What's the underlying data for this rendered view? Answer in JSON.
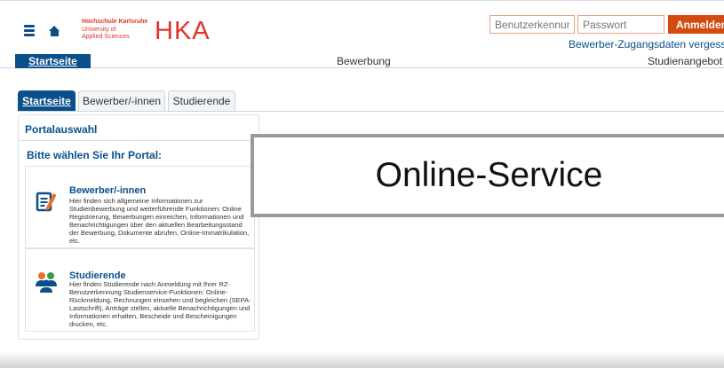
{
  "header": {
    "logo": {
      "line1": "Hochschule Karlsruhe",
      "line2": "University of",
      "line3": "Applied Sciences",
      "mark": "HKA"
    },
    "login": {
      "username_placeholder": "Benutzerkennung",
      "password_placeholder": "Passwort",
      "button_label": "Anmelden",
      "forgot_link": "Bewerber-Zugangsdaten vergessen?"
    }
  },
  "nav": {
    "items": [
      "Startseite",
      "Bewerbung",
      "Studienangebot"
    ],
    "active": "Startseite"
  },
  "tabs": [
    {
      "label": "Startseite",
      "active": true
    },
    {
      "label": "Bewerber/-innen",
      "active": false
    },
    {
      "label": "Studierende",
      "active": false
    }
  ],
  "portal": {
    "title": "Portalauswahl",
    "subtitle": "Bitte wählen Sie Ihr Portal:",
    "cards": [
      {
        "title": "Bewerber/-innen",
        "icon": "application-form-icon",
        "text": "Hier finden sich allgemeine Informationen zur Studienbewerbung und weiterführende Funktionen: Online Registrierung, Bewerbungen einreichen, Informationen und Benachrichtigungen über den aktuellen Bearbeitungsstand der Bewerbung, Dokumente abrufen, Online-Immatrikulation, etc."
      },
      {
        "title": "Studierende",
        "icon": "students-group-icon",
        "text": "Hier finden Studierende nach Anmeldung mit Ihrer RZ-Benutzerkennung Studienservice-Funktionen: Online-Rückmeldung, Rechnungen einsehen und begleichen (SEPA-Lastschrift), Anträge stellen, aktuelle Benachrichtigungen und Informationen erhalten, Bescheide und Bescheinigungen drucken, etc."
      }
    ]
  },
  "overlay": {
    "label": "Online-Service"
  },
  "colors": {
    "primary": "#0b4f8a",
    "brand": "#e4322b",
    "login_button": "#d44b12",
    "icon_orange": "#e8712a",
    "icon_green": "#3a9a4a"
  }
}
